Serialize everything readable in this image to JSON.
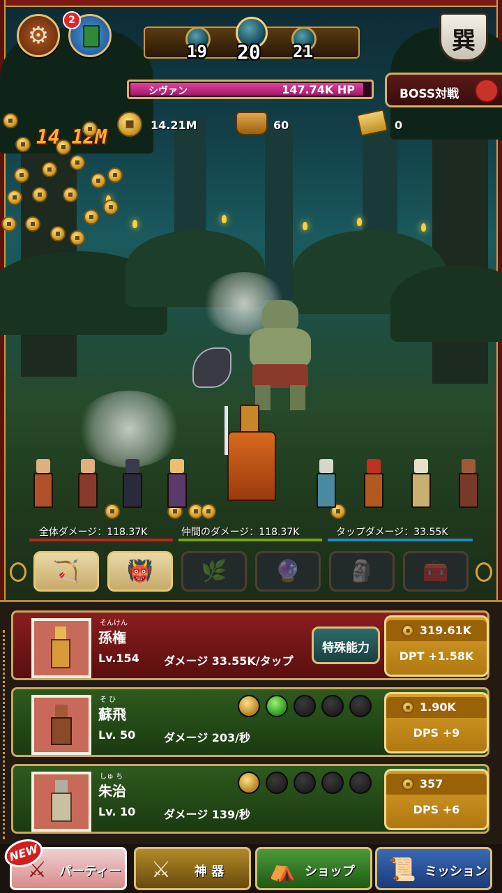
{
  "header": {
    "stages": {
      "prev": "19",
      "current": "20",
      "next": "21"
    },
    "notification_count": "2",
    "settings_icon": "gear-icon",
    "book_icon": "book-icon",
    "banner_glyph": "巽"
  },
  "boss": {
    "name": "シヴァン",
    "hp": "147.74K HP",
    "hp_fraction": 0.98,
    "challenge_label": "BOSS対戦"
  },
  "resources": {
    "gold": "14.21M",
    "ingots": "60",
    "scrolls": "0"
  },
  "floating_damage": "14.12M",
  "stats": {
    "total_damage": "全体ダメージ：118.37K",
    "party_damage": "仲間のダメージ：118.37K",
    "tap_damage": "タップダメージ：33.55K",
    "colors": {
      "total": "#c0241e",
      "party": "#7aa31e",
      "tap": "#2a8ab8"
    }
  },
  "category_tabs": [
    {
      "icon": "weapons-icon",
      "glyph": "🏹",
      "active": true
    },
    {
      "icon": "beast-icon",
      "glyph": "👹",
      "active": true
    },
    {
      "icon": "herb-icon",
      "glyph": "🌿",
      "active": false
    },
    {
      "icon": "jade-icon",
      "glyph": "🔮",
      "active": false
    },
    {
      "icon": "statue-icon",
      "glyph": "🗿",
      "active": false
    },
    {
      "icon": "chest-icon",
      "glyph": "🧰",
      "active": false
    }
  ],
  "heroes": [
    {
      "ruby": "そんけん",
      "name": "孫権",
      "level": "Lv.154",
      "damage": "ダメージ 33.55K/タップ",
      "special_label": "特殊能力",
      "cost": "319.61K",
      "increment": "DPT +1.58K"
    },
    {
      "ruby": "そ ひ",
      "name": "蘇飛",
      "level": "Lv. 50",
      "damage": "ダメージ 203/秒",
      "cost": "1.90K",
      "increment": "DPS +9",
      "gems": [
        "gold",
        "green",
        "empty",
        "empty",
        "empty"
      ]
    },
    {
      "ruby": "しゅ ち",
      "name": "朱治",
      "level": "Lv. 10",
      "damage": "ダメージ 139/秒",
      "cost": "357",
      "increment": "DPS +6",
      "gems": [
        "gold",
        "empty",
        "empty",
        "empty",
        "empty"
      ]
    }
  ],
  "nav": {
    "new_badge": "NEW",
    "party": "パーティー",
    "artifacts": "神 器",
    "shop": "ショップ",
    "missions": "ミッション"
  }
}
